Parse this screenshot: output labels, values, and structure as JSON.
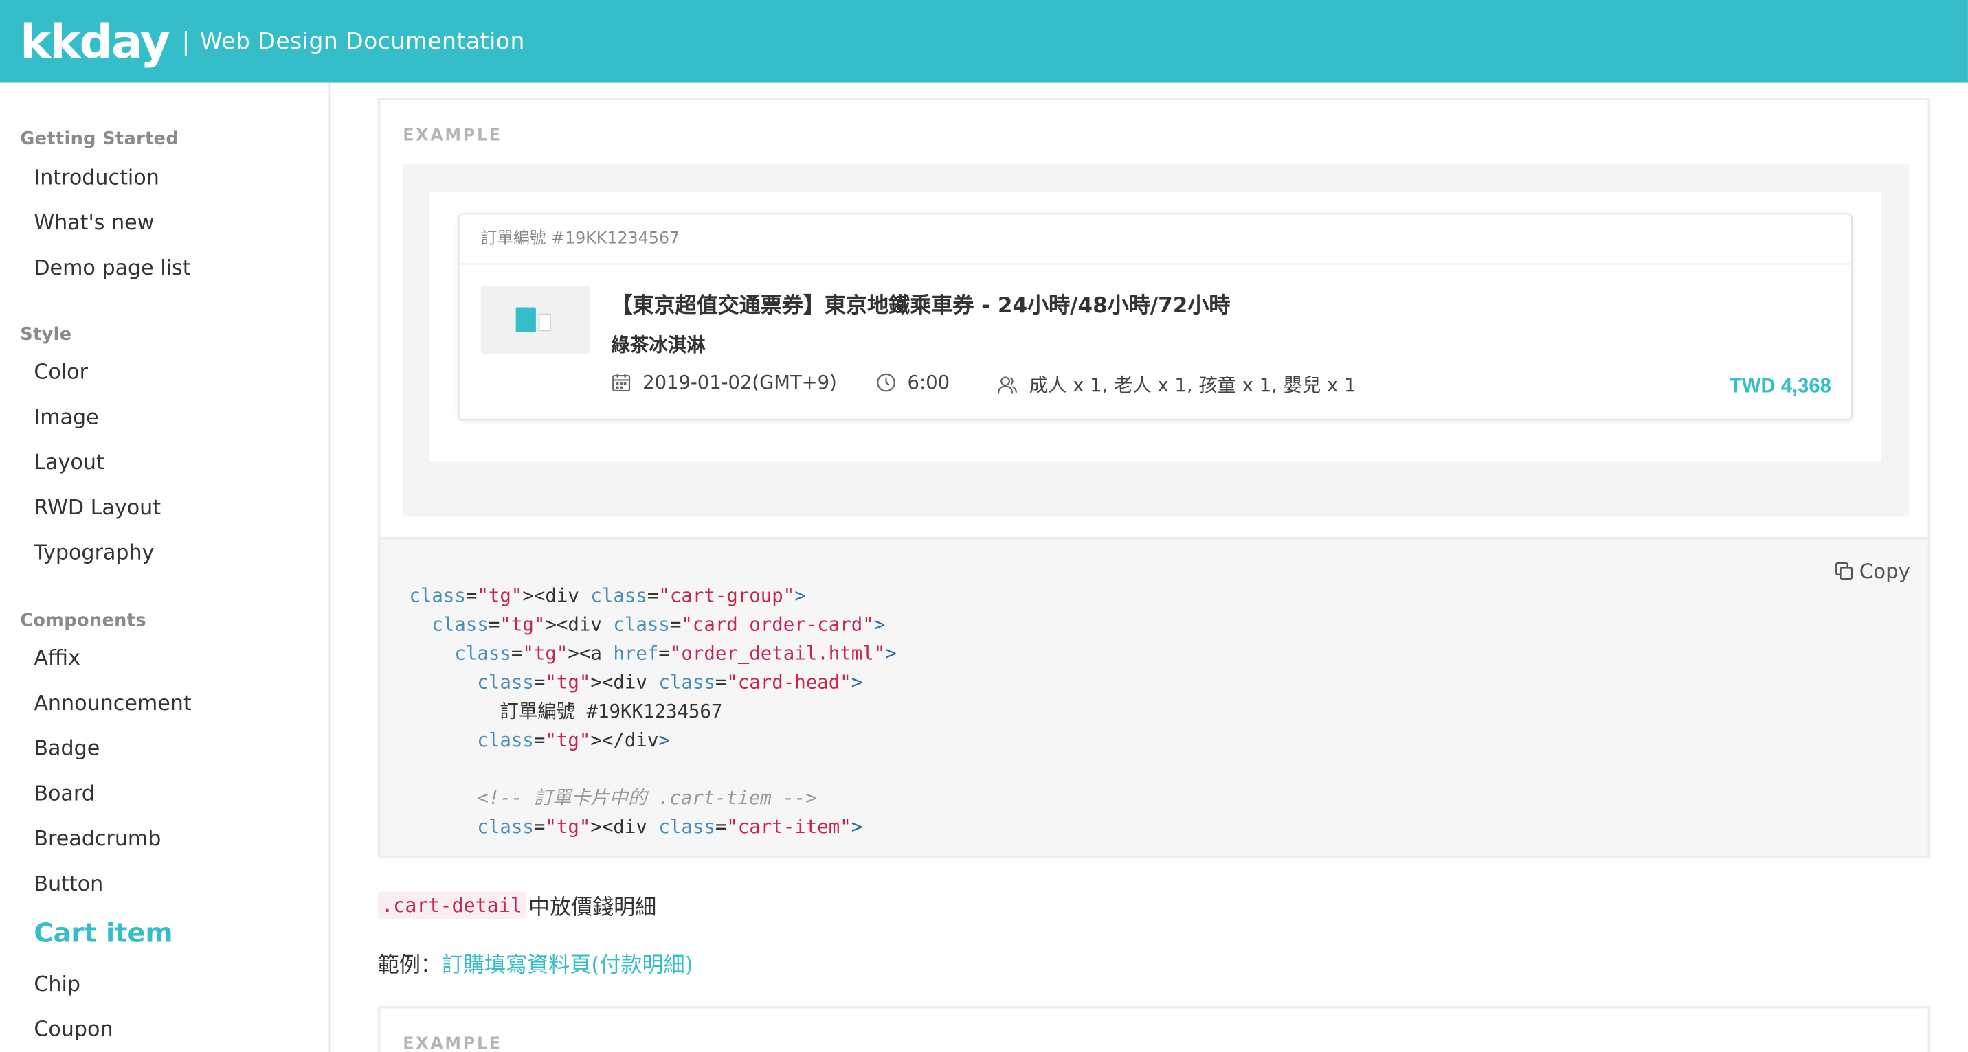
{
  "header": {
    "logo": "kkday",
    "separator": "|",
    "title": "Web Design Documentation"
  },
  "sidebar": {
    "sections": [
      {
        "title": "Getting Started",
        "items": [
          "Introduction",
          "What's new",
          "Demo page list"
        ]
      },
      {
        "title": "Style",
        "items": [
          "Color",
          "Image",
          "Layout",
          "RWD Layout",
          "Typography"
        ]
      },
      {
        "title": "Components",
        "items": [
          "Affix",
          "Announcement",
          "Badge",
          "Board",
          "Breadcrumb",
          "Button",
          "Cart item",
          "Chip",
          "Coupon"
        ]
      }
    ],
    "active_item": "Cart item"
  },
  "example": {
    "label": "EXAMPLE",
    "order_number": "訂單編號 #19KK1234567",
    "item_title": "【東京超值交通票券】東京地鐵乘車券 - 24小時/48小時/72小時",
    "item_subtitle": "綠茶冰淇淋",
    "date": "2019-01-02(GMT+9)",
    "time": "6:00",
    "people": "成人 x 1, 老人 x 1, 孩童 x 1, 嬰兒 x 1",
    "price": "TWD 4,368"
  },
  "code_block": {
    "copy_label": "Copy",
    "lines": [
      "<div class=\"cart-group\">",
      "  <div class=\"card order-card\">",
      "    <a href=\"order_detail.html\">",
      "      <div class=\"card-head\">",
      "        訂單編號 #19KK1234567",
      "      </div>",
      "",
      "      <!-- 訂單卡片中的 .cart-tiem -->",
      "      <div class=\"cart-item\">"
    ]
  },
  "desc": {
    "code": ".cart-detail",
    "text": "中放價錢明細"
  },
  "example_ref": {
    "prefix": "範例：",
    "link": "訂購填寫資料頁(付款明細)"
  },
  "example2": {
    "label": "EXAMPLE"
  },
  "colors": {
    "brand": "#35bec9",
    "code_string": "#c7254e",
    "code_tag": "#2f6f9f"
  }
}
